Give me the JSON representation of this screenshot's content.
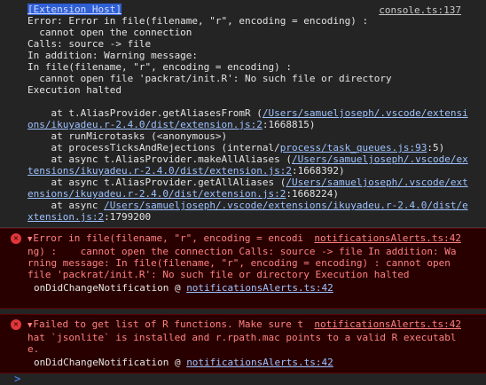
{
  "log": {
    "badge": "[Extension Host]",
    "source": "console.ts:137",
    "lines": [
      "Error: Error in file(filename, \"r\", encoding = encoding) :",
      "  cannot open the connection",
      "Calls: source -> file",
      "In addition: Warning message:",
      "In file(filename, \"r\", encoding = encoding) :",
      "  cannot open file 'packrat/init.R': No such file or directory",
      "Execution halted"
    ],
    "trace": [
      {
        "prefix": "    at t.AliasProvider.getAliasesFromR (",
        "link": "/Users/samueljoseph/.vscode/extensions/ikuyadeu.r-2.4.0/dist/extension.js:2",
        "suffix": ":1668815)"
      },
      {
        "prefix": "    at runMicrotasks (<anonymous>)",
        "link": "",
        "suffix": ""
      },
      {
        "prefix": "    at processTicksAndRejections (internal/",
        "link": "process/task_queues.js:93",
        "suffix": ":5)"
      },
      {
        "prefix": "    at async t.AliasProvider.makeAllAliases (",
        "link": "/Users/samueljoseph/.vscode/extensions/ikuyadeu.r-2.4.0/dist/extension.js:2",
        "suffix": ":1668392)"
      },
      {
        "prefix": "    at async t.AliasProvider.getAllAliases (",
        "link": "/Users/samueljoseph/.vscode/extensions/ikuyadeu.r-2.4.0/dist/extension.js:2",
        "suffix": ":1668224)"
      },
      {
        "prefix": "    at async ",
        "link": "/Users/samueljoseph/.vscode/extensions/ikuyadeu.r-2.4.0/dist/extension.js:2",
        "suffix": ":1799200"
      }
    ]
  },
  "errors": [
    {
      "icon": "error-icon",
      "text": "Error in file(filename, \"r\", encoding = encoding) :    cannot open the connection Calls: source -> file In addition: Warning message: In file(filename, \"r\", encoding = encoding) : cannot open file 'packrat/init.R': No such file or directory Execution halted",
      "source": "notificationsAlerts.ts:42",
      "caller": "onDidChangeNotification @ ",
      "caller_link": "notificationsAlerts.ts:42"
    },
    {
      "icon": "error-icon",
      "text": "Failed to get list of R functions. Make sure that `jsonlite` is installed and r.rpath.mac points to a valid R executable.",
      "source": "notificationsAlerts.ts:42",
      "caller": "onDidChangeNotification @ ",
      "caller_link": "notificationsAlerts.ts:42"
    }
  ],
  "prompt": {
    "symbol": ">",
    "color": "#4a8cff"
  }
}
